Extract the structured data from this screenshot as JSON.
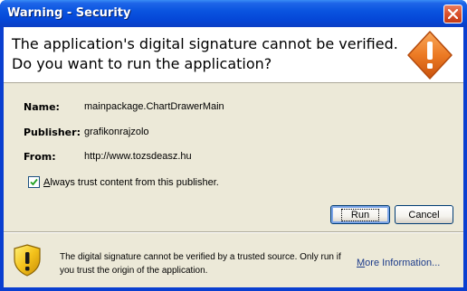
{
  "window": {
    "title": "Warning - Security"
  },
  "header": {
    "line1": "The application's digital signature cannot be verified.",
    "line2": "Do you want to run the application?"
  },
  "details": {
    "name_label": "Name:",
    "name_value": "mainpackage.ChartDrawerMain",
    "publisher_label": "Publisher:",
    "publisher_value": "grafikonrajzolo",
    "from_label": "From:",
    "from_value": "http://www.tozsdeasz.hu"
  },
  "trust_checkbox": {
    "checked": true,
    "label_underlined": "A",
    "label_rest": "lways trust content from this publisher."
  },
  "buttons": {
    "run_label": "Run",
    "cancel_label": "Cancel"
  },
  "footer": {
    "message": "The digital signature cannot be verified by a trusted source.  Only run if you trust the origin of the application.",
    "more_info_underlined": "M",
    "more_info_rest": "ore Information..."
  },
  "icons": {
    "close": "close-icon",
    "header_warning": "warning-diamond-icon",
    "footer_warning": "warning-shield-icon",
    "checkmark": "checkmark-icon"
  },
  "colors": {
    "titlebar": "#0a54e0",
    "dialog_background": "#ece9d8",
    "warning_orange": "#e8731f",
    "shield_yellow": "#f4c21b",
    "link": "#1c3b8a"
  }
}
